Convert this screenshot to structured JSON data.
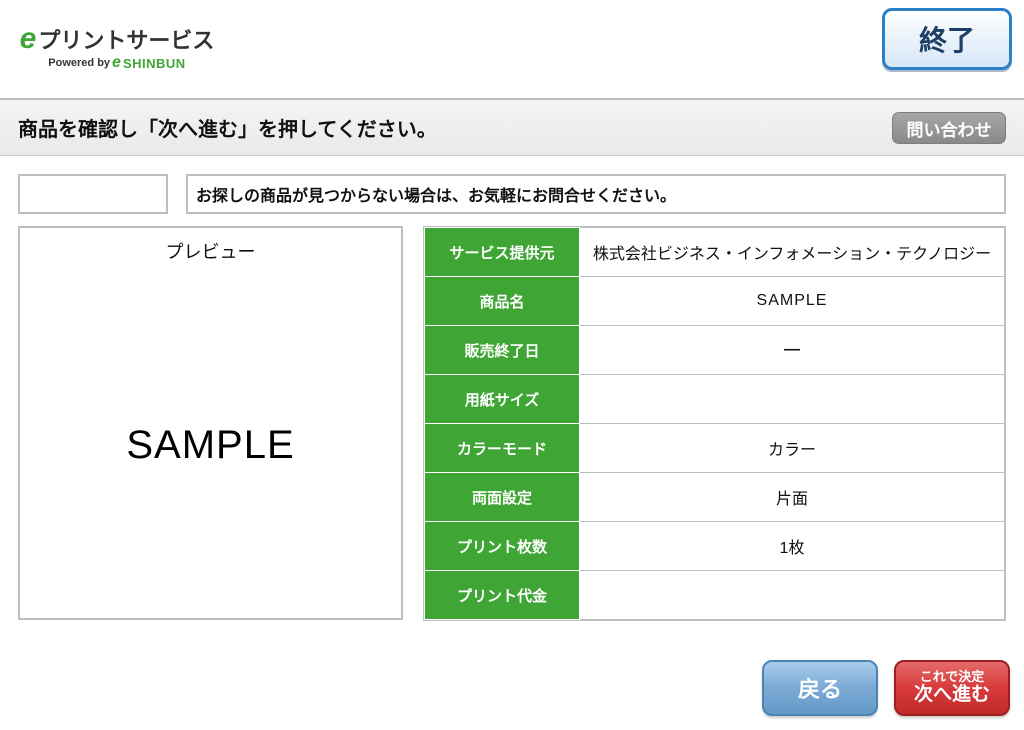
{
  "logo": {
    "e": "e",
    "main": "プリントサービス",
    "powered_by": "Powered by",
    "e2": "e",
    "shinbun": "SHINBUN"
  },
  "header": {
    "exit_label": "終了"
  },
  "instruction": {
    "text": "商品を確認し「次へ進む」を押してください。",
    "inquiry_label": "問い合わせ"
  },
  "notice": {
    "text": "お探しの商品が見つからない場合は、お気軽にお問合せください。"
  },
  "preview": {
    "title": "プレビュー",
    "sample": "SAMPLE"
  },
  "details": {
    "rows": [
      {
        "label": "サービス提供元",
        "value": "株式会社ビジネス・インフォメーション・テクノロジー"
      },
      {
        "label": "商品名",
        "value": "SAMPLE"
      },
      {
        "label": "販売終了日",
        "value": "―"
      },
      {
        "label": "用紙サイズ",
        "value": ""
      },
      {
        "label": "カラーモード",
        "value": "カラー"
      },
      {
        "label": "両面設定",
        "value": "片面"
      },
      {
        "label": "プリント枚数",
        "value": "1枚"
      },
      {
        "label": "プリント代金",
        "value": ""
      }
    ]
  },
  "buttons": {
    "back": "戻る",
    "next_line1": "これで決定",
    "next_line2": "次へ進む"
  }
}
